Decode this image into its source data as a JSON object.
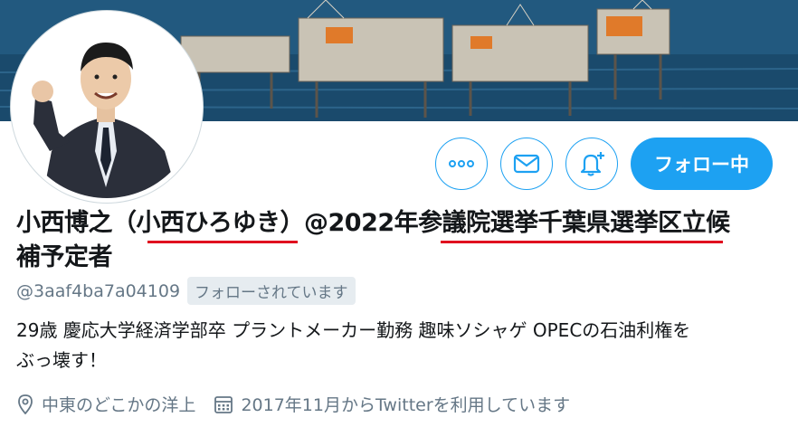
{
  "profile": {
    "name_line1": "小西博之（小西ひろゆき）@2022年参議院選挙千葉県選挙区立候",
    "name_line2": "補予定者",
    "handle": "@3aaf4ba7a04109",
    "follows_you": "フォローされています",
    "bio_line1": "29歳 慶応大学経済学部卒 プラントメーカー勤務 趣味ソシャゲ OPECの石油利権を",
    "bio_line2": "ぶっ壊す！",
    "location": "中東のどこかの洋上",
    "joined": "2017年11月からTwitterを利用しています"
  },
  "actions": {
    "follow_label": "フォロー中",
    "more_icon": "more-icon",
    "message_icon": "mail-icon",
    "notify_icon": "bell-plus-icon"
  },
  "colors": {
    "accent": "#1da1f2",
    "underline": "#e0101f",
    "muted": "#657786"
  }
}
